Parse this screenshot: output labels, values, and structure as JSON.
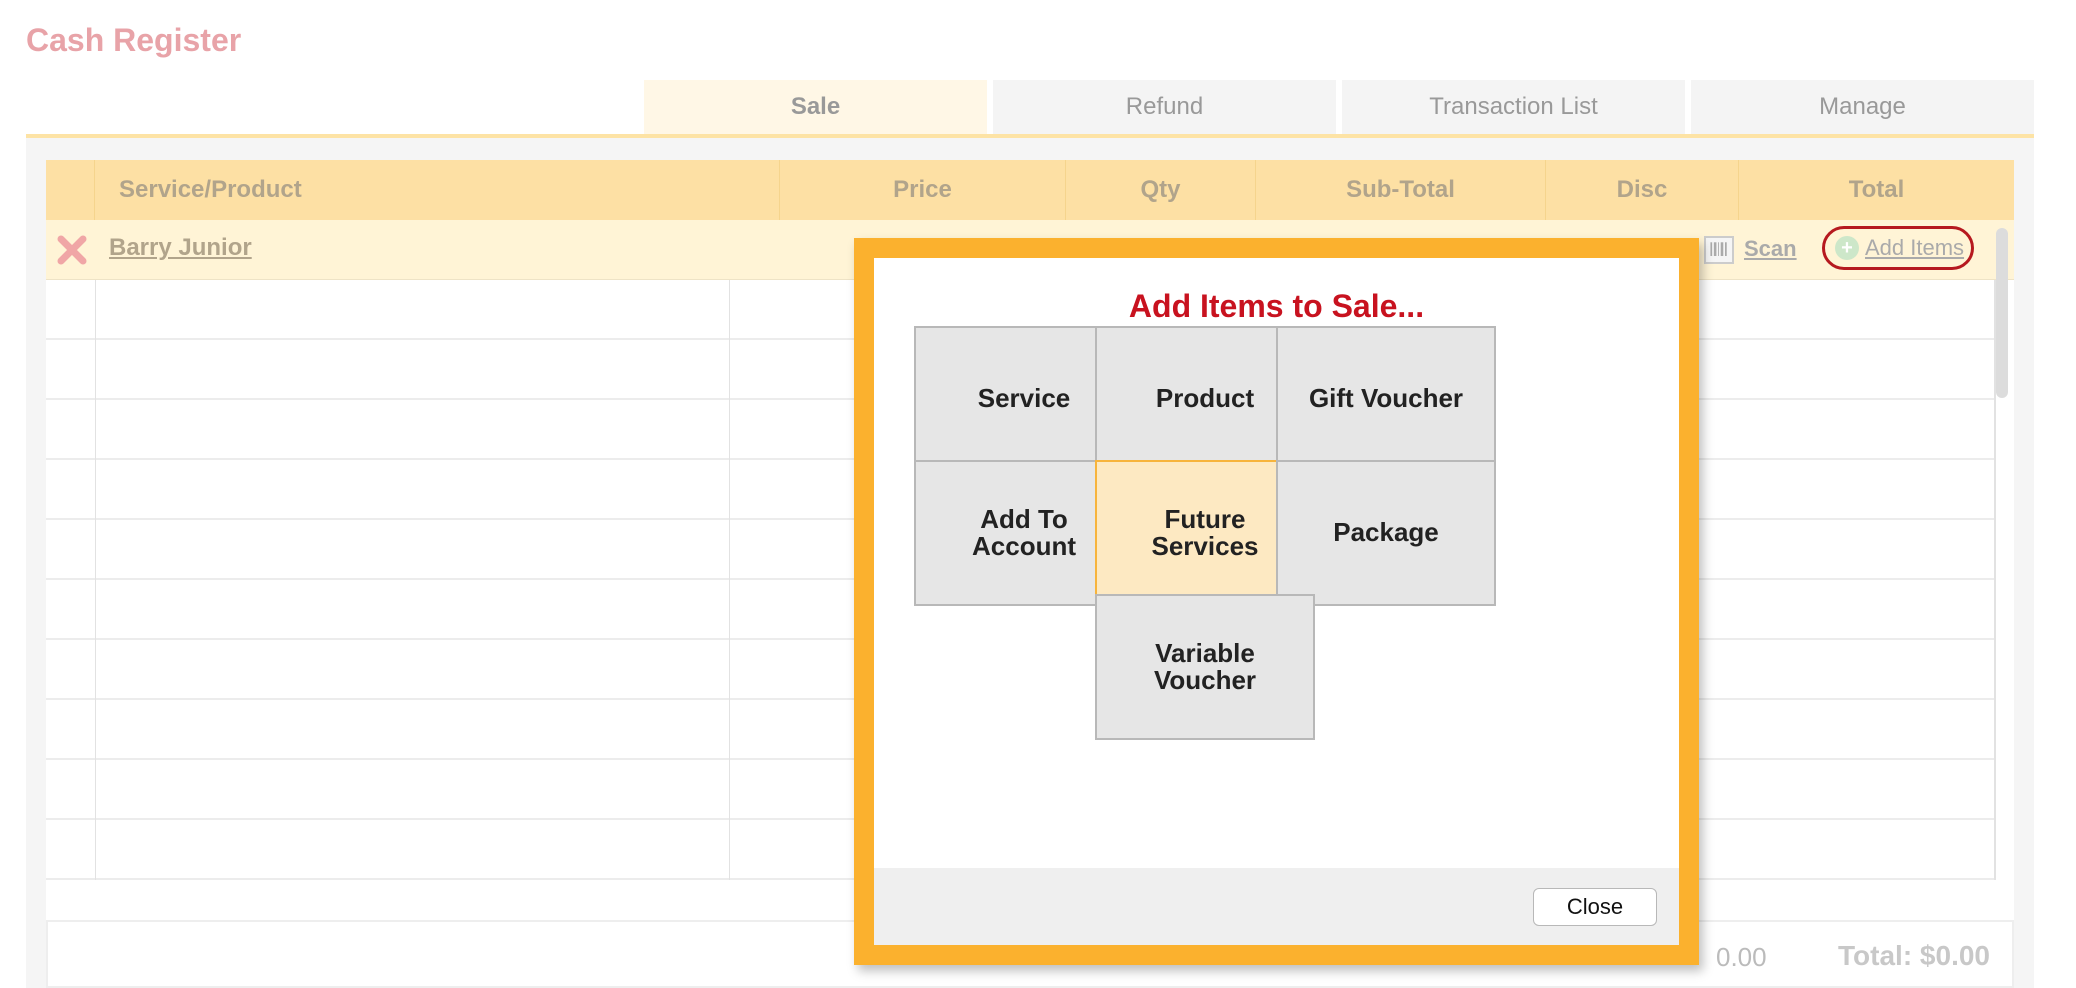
{
  "page": {
    "title": "Cash Register"
  },
  "tabs": [
    {
      "label": "Sale",
      "active": true
    },
    {
      "label": "Refund",
      "active": false
    },
    {
      "label": "Transaction List",
      "active": false
    },
    {
      "label": "Manage",
      "active": false
    }
  ],
  "table": {
    "columns": [
      "Service/Product",
      "Price",
      "Qty",
      "Sub-Total",
      "Disc",
      "Total"
    ],
    "customer": {
      "name": "Barry Junior"
    },
    "actions": {
      "scan_label": "Scan",
      "add_items_label": "Add Items"
    },
    "empty_rows": 10
  },
  "totals": {
    "subtotal_partial": "0.00",
    "total": "Total: $0.00"
  },
  "dialog": {
    "title": "Add Items to Sale...",
    "options": [
      {
        "label": "Service",
        "selected": false
      },
      {
        "label": "Product",
        "selected": false
      },
      {
        "label": "Gift Voucher",
        "selected": false
      },
      {
        "label": "Add To Account",
        "selected": false
      },
      {
        "label": "Future Services",
        "selected": true
      },
      {
        "label": "Package",
        "selected": false
      },
      {
        "label": "Variable Voucher",
        "selected": false
      }
    ],
    "close_label": "Close"
  },
  "colors": {
    "title": "#e8a3a8",
    "accent": "#fbb12e",
    "header_bg": "#fde0a4",
    "dialog_title": "#c8121f",
    "highlight_ring": "#b6191f"
  },
  "icons": {
    "remove": "close-x-icon",
    "scan": "barcode-icon",
    "add": "plus-circle-icon"
  }
}
